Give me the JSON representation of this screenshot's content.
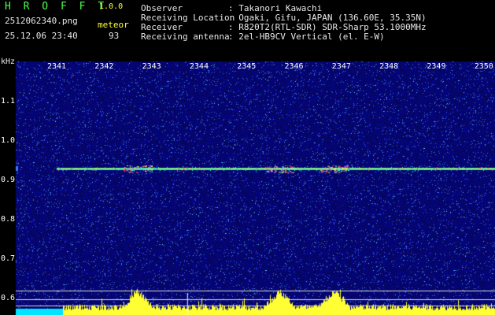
{
  "header": {
    "logo": "H R O F F T",
    "version": "1.0.0",
    "filename": "2512062340.png",
    "meteor_label": "meteor",
    "datetime": "25.12.06 23:40",
    "meteor_count": "93",
    "fields": [
      {
        "label": "Observer",
        "value": ": Takanori Kawachi"
      },
      {
        "label": "Receiving Location",
        "value": ": Ogaki, Gifu, JAPAN (136.60E, 35.35N)"
      },
      {
        "label": "Receiver",
        "value": ": R820T2(RTL-SDR) SDR-Sharp 53.1000MHz"
      },
      {
        "label": "Receiving antenna",
        "value": ": 2el-HB9CV Vertical (el. E-W)"
      }
    ]
  },
  "chart_data": {
    "type": "heatmap",
    "ylabel": "kHz",
    "yticks": [
      "1.1",
      "1.0",
      "0.9",
      "0.8",
      "0.7",
      "0.6"
    ],
    "xticks": [
      "2341",
      "2342",
      "2343",
      "2344",
      "2345",
      "2346",
      "2347",
      "2348",
      "2349",
      "2350"
    ],
    "ylim": [
      0.58,
      1.2
    ],
    "xlim": [
      2340.3,
      2350.35
    ],
    "carrier_khz": 0.93,
    "carrier_start": 2341.0,
    "bursts": [
      2342.7,
      2345.7,
      2346.85
    ]
  },
  "colors": {
    "background": "#000000",
    "noise_base": "#0a0a6e",
    "carrier": "#ffff33",
    "label_green": "#4cff4c"
  }
}
